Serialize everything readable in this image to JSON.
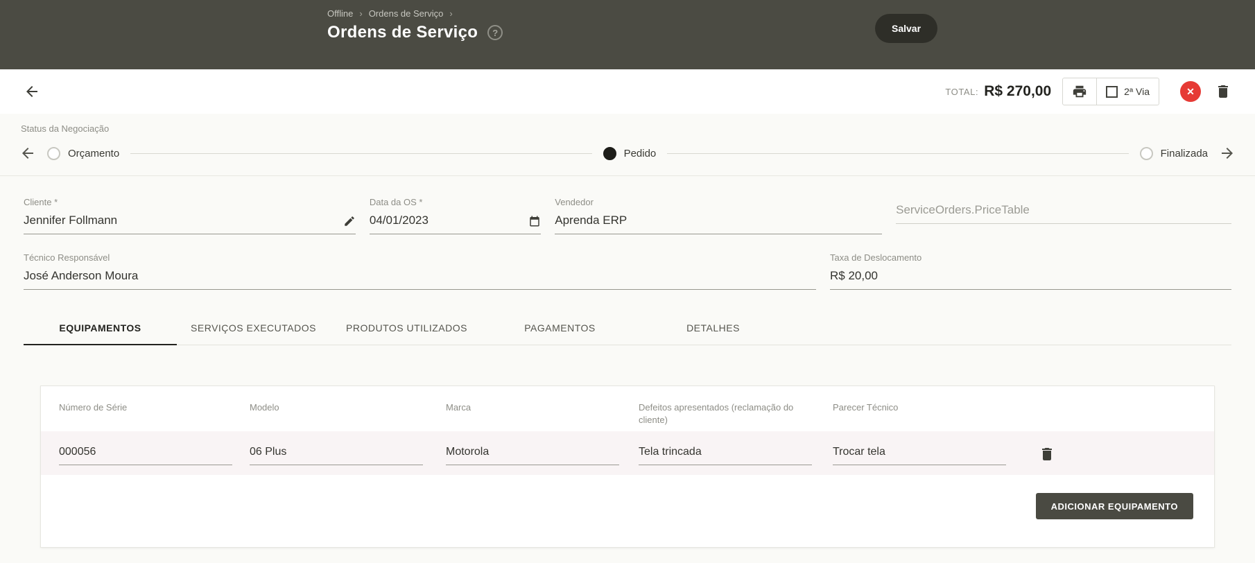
{
  "header": {
    "breadcrumb": {
      "items": [
        "Offline",
        "Ordens de Serviço"
      ],
      "separator": "›"
    },
    "title": "Ordens de Serviço",
    "save_label": "Salvar"
  },
  "icons": {
    "help_glyph": "?",
    "close_glyph": "✕"
  },
  "toolbar": {
    "total_label": "TOTAL:",
    "total_value": "R$ 270,00",
    "second_copy_label": "2ª Via"
  },
  "status": {
    "section_label": "Status da Negociação",
    "steps": [
      {
        "label": "Orçamento",
        "state": "inactive"
      },
      {
        "label": "Pedido",
        "state": "active"
      },
      {
        "label": "Finalizada",
        "state": "inactive"
      }
    ]
  },
  "form": {
    "cliente": {
      "label": "Cliente *",
      "value": "Jennifer Follmann"
    },
    "data_os": {
      "label": "Data da OS *",
      "value": "04/01/2023"
    },
    "vendedor": {
      "label": "Vendedor",
      "value": "Aprenda ERP"
    },
    "price_table": {
      "placeholder": "ServiceOrders.PriceTable"
    },
    "tecnico": {
      "label": "Técnico Responsável",
      "value": "José Anderson Moura"
    },
    "taxa": {
      "label": "Taxa de Deslocamento",
      "value": "R$ 20,00"
    }
  },
  "tabs": [
    {
      "label": "EQUIPAMENTOS",
      "active": true
    },
    {
      "label": "SERVIÇOS EXECUTADOS",
      "active": false
    },
    {
      "label": "PRODUTOS UTILIZADOS",
      "active": false
    },
    {
      "label": "PAGAMENTOS",
      "active": false
    },
    {
      "label": "DETALHES",
      "active": false
    }
  ],
  "equipment_table": {
    "columns": [
      "Número de Série",
      "Modelo",
      "Marca",
      "Defeitos apresentados (reclamação do cliente)",
      "Parecer Técnico"
    ],
    "rows": [
      {
        "numero_serie": "000056",
        "modelo": "06 Plus",
        "marca": "Motorola",
        "defeitos": "Tela trincada",
        "parecer": "Trocar tela"
      }
    ],
    "add_button_label": "ADICIONAR EQUIPAMENTO"
  },
  "colors": {
    "header_bg": "#4b4b43",
    "button_dark": "#2e2e28",
    "danger": "#e63a35",
    "page_bg": "#fafaf7",
    "row_bg": "#f9f4f5"
  }
}
